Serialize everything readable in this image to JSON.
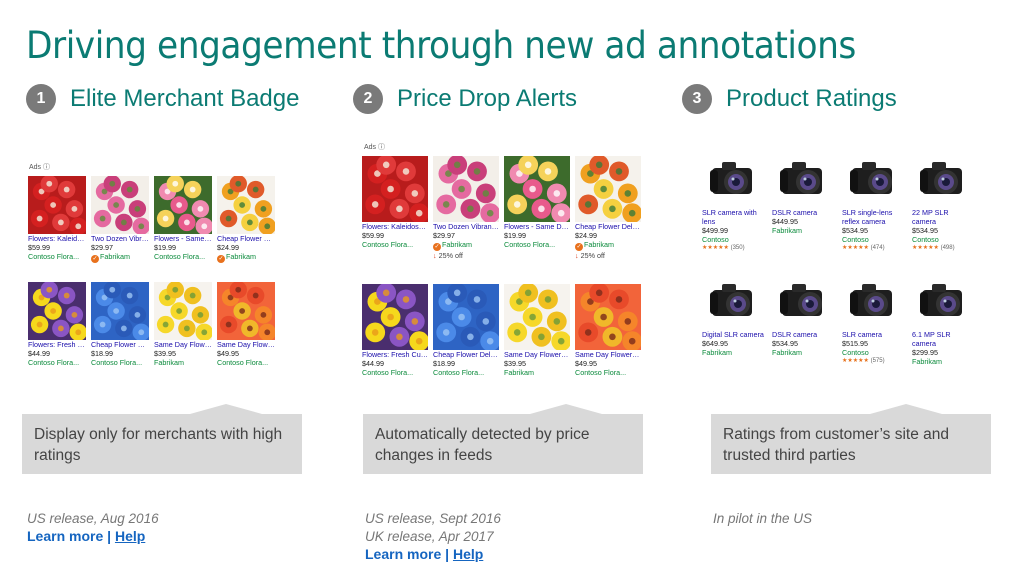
{
  "title": "Driving engagement through new ad annotations",
  "columns": [
    {
      "num": "1",
      "title": "Elite Merchant Badge",
      "callout": "Display only for merchants with high ratings",
      "notes": [
        "US release, Aug 2016"
      ],
      "learn_more": "Learn more",
      "separator": "|",
      "help": "Help"
    },
    {
      "num": "2",
      "title": "Price Drop Alerts",
      "callout": "Automatically detected by price changes in feeds",
      "notes": [
        "US release, Sept 2016",
        "UK release, Apr 2017"
      ],
      "learn_more": "Learn more",
      "separator": "|",
      "help": "Help"
    },
    {
      "num": "3",
      "title": "Product Ratings",
      "callout": "Ratings from customer’s site and trusted third parties",
      "notes": [
        "In pilot in the US"
      ]
    }
  ],
  "ads_label": "Ads ⓘ",
  "flower_ads_row1": [
    {
      "title": "Flowers: Kaleidoscope ...",
      "price": "$59.99",
      "merchant": "Contoso Flora..."
    },
    {
      "title": "Two Dozen Vibrant Birthda...",
      "price": "$29.97",
      "merchant": "Fabrikam",
      "badge": true,
      "drop": "25% off"
    },
    {
      "title": "Flowers - Same Day Delivery - ...",
      "price": "$19.99",
      "merchant": "Contoso Flora..."
    },
    {
      "title": "Cheap Flower Delivery: Pink ...",
      "price": "$24.99",
      "merchant": "Fabrikam",
      "badge": true,
      "drop": "25% off"
    }
  ],
  "flower_ads_row2": [
    {
      "title": "Flowers: Fresh Cuts Lisianthu...",
      "price": "$44.99",
      "merchant": "Contoso Flora..."
    },
    {
      "title": "Cheap Flower Delivery: Flora...",
      "price": "$18.99",
      "merchant": "Contoso Flora..."
    },
    {
      "title": "Same Day Flower Deliver...",
      "price": "$39.95",
      "merchant": "Fabrikam"
    },
    {
      "title": "Same Day Flower Deliver...",
      "price": "$49.95",
      "merchant": "Contoso Flora..."
    }
  ],
  "camera_ads": [
    {
      "title": "SLR camera with lens",
      "price": "$499.99",
      "merchant": "Contoso",
      "stars": "★★★★★",
      "count": "(350)"
    },
    {
      "title": "DSLR camera",
      "price": "$449.95",
      "merchant": "Fabrikam"
    },
    {
      "title": "SLR single-lens reflex camera",
      "price": "$534.95",
      "merchant": "Contoso",
      "stars": "★★★★★",
      "count": "(474)"
    },
    {
      "title": "22 MP SLR camera",
      "price": "$534.95",
      "merchant": "Contoso",
      "stars": "★★★★★",
      "count": "(498)"
    },
    {
      "title": "Digital SLR camera",
      "price": "$649.95",
      "merchant": "Fabrikam"
    },
    {
      "title": "DSLR camera",
      "price": "$534.95",
      "merchant": "Fabrikam"
    },
    {
      "title": "SLR camera",
      "price": "$515.95",
      "merchant": "Contoso",
      "stars": "★★★★★",
      "count": "(575)"
    },
    {
      "title": "6.1 MP SLR camera",
      "price": "$299.95",
      "merchant": "Fabrikam"
    }
  ],
  "colors": {
    "accent": "#0b7b73",
    "link": "#1565c0",
    "callout_bg": "#d9d9d9",
    "ad_title": "#1a0dab",
    "merchant": "#0a8a3b",
    "star": "#e7711b"
  }
}
